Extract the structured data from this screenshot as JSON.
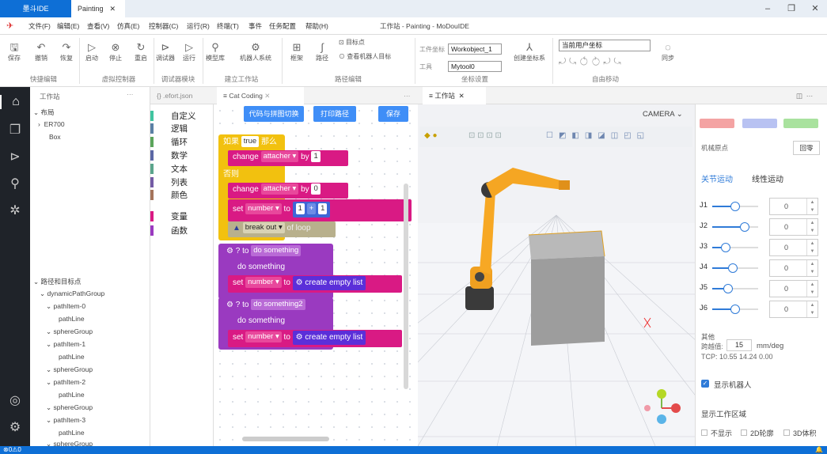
{
  "title_tab": "墨斗IDE",
  "doc_tab": "Painting",
  "window_title": "工作站 - Painting - MoDouIDE",
  "menu": [
    "文件(F)",
    "编辑(E)",
    "查看(V)",
    "仿真(E)",
    "控制器(C)",
    "运行(R)",
    "终端(T)",
    "事件",
    "任务配置",
    "帮助(H)"
  ],
  "ribbon": {
    "quick_edit": {
      "items": [
        "保存",
        "撤销",
        "恢复"
      ],
      "group": "快捷编辑"
    },
    "virtual_controller": {
      "items": [
        "启动",
        "停止",
        "重启"
      ],
      "group": "虚拟控制器"
    },
    "debugger": {
      "items": [
        "调试器",
        "运行"
      ],
      "group": "调试器模块"
    },
    "build_station": {
      "items": [
        "模型库",
        "机器人系统"
      ],
      "group": "建立工作站"
    },
    "path_edit": {
      "items": [
        "框架",
        "路径",
        "目标点",
        "查看机器人目标"
      ],
      "group": "路径编辑"
    },
    "coord": {
      "workobj_label": "工件坐标",
      "workobj_value": "Workobject_1",
      "tool_label": "工具",
      "tool_value": "Mytool0",
      "create_label": "创建坐标系",
      "group": "坐标设置"
    },
    "free_move": {
      "coord_value": "当前用户坐标",
      "group": "自由移动"
    },
    "sync": "同步"
  },
  "explorer": {
    "title": "工作站",
    "layout_title": "布局",
    "layout_items": [
      "ER700",
      "Box"
    ],
    "paths_title": "路径和目标点",
    "tree": [
      "dynamicPathGroup",
      "pathItem-0",
      "pathLine",
      "sphereGroup",
      "pathItem-1",
      "pathLine",
      "sphereGroup",
      "pathItem-2",
      "pathLine",
      "sphereGroup",
      "pathItem-3",
      "pathLine",
      "sphereGroup"
    ]
  },
  "tabs": {
    "efort": "{} .efort.json",
    "catcoding": "Cat Coding",
    "workstation": "工作站"
  },
  "blockly": {
    "categories": [
      {
        "label": "自定义",
        "color": "#40c4a0"
      },
      {
        "label": "逻辑",
        "color": "#5b80a5"
      },
      {
        "label": "循环",
        "color": "#5ba55b"
      },
      {
        "label": "数学",
        "color": "#5b67a5"
      },
      {
        "label": "文本",
        "color": "#5ba58c"
      },
      {
        "label": "列表",
        "color": "#745ba5"
      },
      {
        "label": "颜色",
        "color": "#a5745b"
      },
      {
        "label": "变量",
        "color": "#d91a84"
      },
      {
        "label": "函数",
        "color": "#9a3ac0"
      }
    ],
    "buttons": [
      "代码与拼图切换",
      "打印路径",
      "保存"
    ],
    "if_label": "如果",
    "true_val": "true",
    "then_label": "那么",
    "else_label": "否则",
    "change": "change",
    "attacher": "attacher",
    "by": "by",
    "one": "1",
    "zero": "0",
    "set": "set",
    "number": "number",
    "to": "to",
    "plus": "+",
    "break_out": "break out",
    "of_loop": "of loop",
    "to_kw": "to",
    "do_something": "do something",
    "do_something2": "do something2",
    "create_empty_list": "create empty list"
  },
  "viewport": {
    "camera": "CAMERA"
  },
  "right_panel": {
    "mech_origin": "机械原点",
    "reset": "回零",
    "joint_motion": "关节运动",
    "linear_motion": "线性运动",
    "joints": [
      {
        "name": "J1",
        "value": "0",
        "pct": 0.5
      },
      {
        "name": "J2",
        "value": "0",
        "pct": 0.7
      },
      {
        "name": "J3",
        "value": "0",
        "pct": 0.3
      },
      {
        "name": "J4",
        "value": "0",
        "pct": 0.45
      },
      {
        "name": "J5",
        "value": "0",
        "pct": 0.35
      },
      {
        "name": "J6",
        "value": "0",
        "pct": 0.5
      }
    ],
    "other": "其他",
    "step_label": "跨越值:",
    "step_value": "15",
    "step_unit": "mm/deg",
    "tcp": "TCP: 10.55 14.24 0.00",
    "show_robot": "显示机器人",
    "show_workspace": "显示工作区域",
    "opt_none": "不显示",
    "opt_2d": "2D轮廓",
    "opt_3d": "3D体积"
  },
  "status": {
    "left": "⊗0⚠0"
  }
}
